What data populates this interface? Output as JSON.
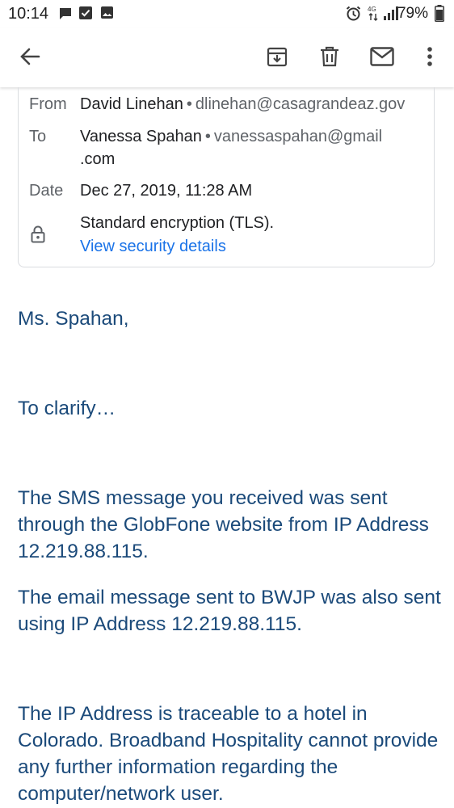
{
  "status_bar": {
    "time": "10:14",
    "battery": "79%",
    "left_icons": [
      "message-icon",
      "check-box-icon",
      "photo-icon"
    ],
    "right_icons": [
      "alarm-icon",
      "data-signal-icon",
      "signal-icon",
      "battery-icon"
    ]
  },
  "app_bar": {
    "icons": [
      "back-arrow-icon",
      "archive-icon",
      "delete-icon",
      "mark-unread-icon",
      "more-vert-icon"
    ]
  },
  "header": {
    "from_label": "From",
    "from_name": "David Linehan",
    "from_email": "dlinehan@casagrandeaz.gov",
    "to_label": "To",
    "to_name": "Vanessa Spahan",
    "to_email_line1": "vanessaspahan@gmail",
    "to_email_line2": ".com",
    "date_label": "Date",
    "date_value": "Dec 27, 2019, 11:28 AM",
    "encryption_text": "Standard encryption (TLS).",
    "security_link": "View security details"
  },
  "body": {
    "greeting": "Ms. Spahan,",
    "p1": "To clarify…",
    "p2": "The SMS message you received was sent through the GlobFone website from IP Address 12.219.88.115.",
    "p3": "The email message sent to BWJP was also sent using IP Address 12.219.88.115.",
    "p4": "The IP Address is traceable to a hotel in Colorado.  Broadband Hospitality cannot provide any further information regarding the computer/network user."
  },
  "colors": {
    "body_text": "#1b4a7a",
    "link": "#1a73e8",
    "label": "#5f6368"
  }
}
